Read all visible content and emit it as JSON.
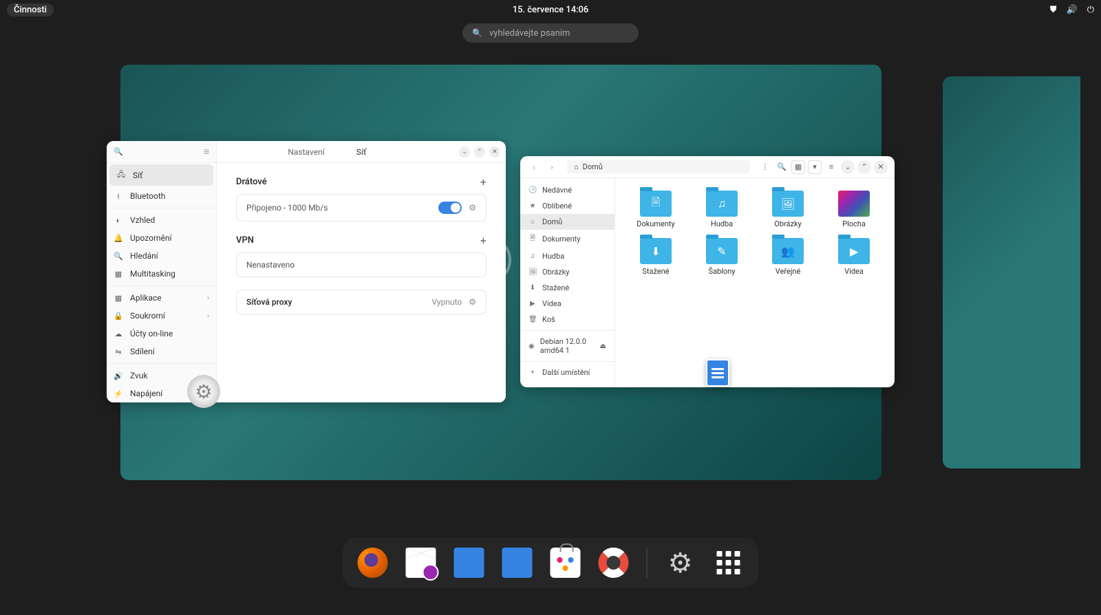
{
  "topbar": {
    "activities": "Činnosti",
    "datetime": "15. července  14:06"
  },
  "search": {
    "placeholder": "vyhledávejte psaním"
  },
  "settings": {
    "sidebar_title": "Nastavení",
    "items": [
      {
        "icon": "🖧",
        "label": "Síť",
        "active": true
      },
      {
        "icon": "ᚼ",
        "label": "Bluetooth"
      }
    ],
    "items2": [
      {
        "icon": "◐",
        "label": "Vzhled"
      },
      {
        "icon": "🔔",
        "label": "Upozornění"
      },
      {
        "icon": "🔍",
        "label": "Hledání"
      },
      {
        "icon": "▦",
        "label": "Multitasking"
      }
    ],
    "items3": [
      {
        "icon": "▦",
        "label": "Aplikace",
        "chev": true
      },
      {
        "icon": "🔒",
        "label": "Soukromí",
        "chev": true
      },
      {
        "icon": "☁",
        "label": "Účty on-line"
      },
      {
        "icon": "⇋",
        "label": "Sdílení"
      }
    ],
    "items4": [
      {
        "icon": "🔊",
        "label": "Zvuk"
      },
      {
        "icon": "⚡",
        "label": "Napájení"
      }
    ],
    "main_title": "Síť",
    "wired_title": "Drátové",
    "wired_status": "Připojeno - 1000 Mb/s",
    "vpn_title": "VPN",
    "vpn_status": "Nenastaveno",
    "proxy_title": "Síťová proxy",
    "proxy_status": "Vypnuto"
  },
  "files": {
    "location_label": "Domů",
    "sidebar": [
      {
        "icon": "🕒",
        "label": "Nedávné"
      },
      {
        "icon": "★",
        "label": "Oblíbené"
      },
      {
        "icon": "⌂",
        "label": "Domů",
        "active": true
      },
      {
        "icon": "🗎",
        "label": "Dokumenty"
      },
      {
        "icon": "♫",
        "label": "Hudba"
      },
      {
        "icon": "🖼",
        "label": "Obrázky"
      },
      {
        "icon": "⬇",
        "label": "Stažené"
      },
      {
        "icon": "▶",
        "label": "Videa"
      },
      {
        "icon": "🗑",
        "label": "Koš"
      }
    ],
    "disk": {
      "icon": "◉",
      "label": "Debian 12.0.0 amd64 1"
    },
    "other": {
      "icon": "+",
      "label": "Další umístění"
    },
    "folders": [
      {
        "glyph": "🗎",
        "label": "Dokumenty"
      },
      {
        "glyph": "♫",
        "label": "Hudba"
      },
      {
        "glyph": "🖼",
        "label": "Obrázky"
      },
      {
        "glyph": "",
        "label": "Plocha",
        "desktop": true
      },
      {
        "glyph": "⬇",
        "label": "Stažené"
      },
      {
        "glyph": "✎",
        "label": "Šablony"
      },
      {
        "glyph": "👥",
        "label": "Veřejné"
      },
      {
        "glyph": "▶",
        "label": "Videa"
      }
    ]
  },
  "dock": {
    "items": [
      "firefox",
      "mail",
      "writer",
      "files",
      "software",
      "help"
    ],
    "items2": [
      "settings",
      "apps"
    ]
  }
}
